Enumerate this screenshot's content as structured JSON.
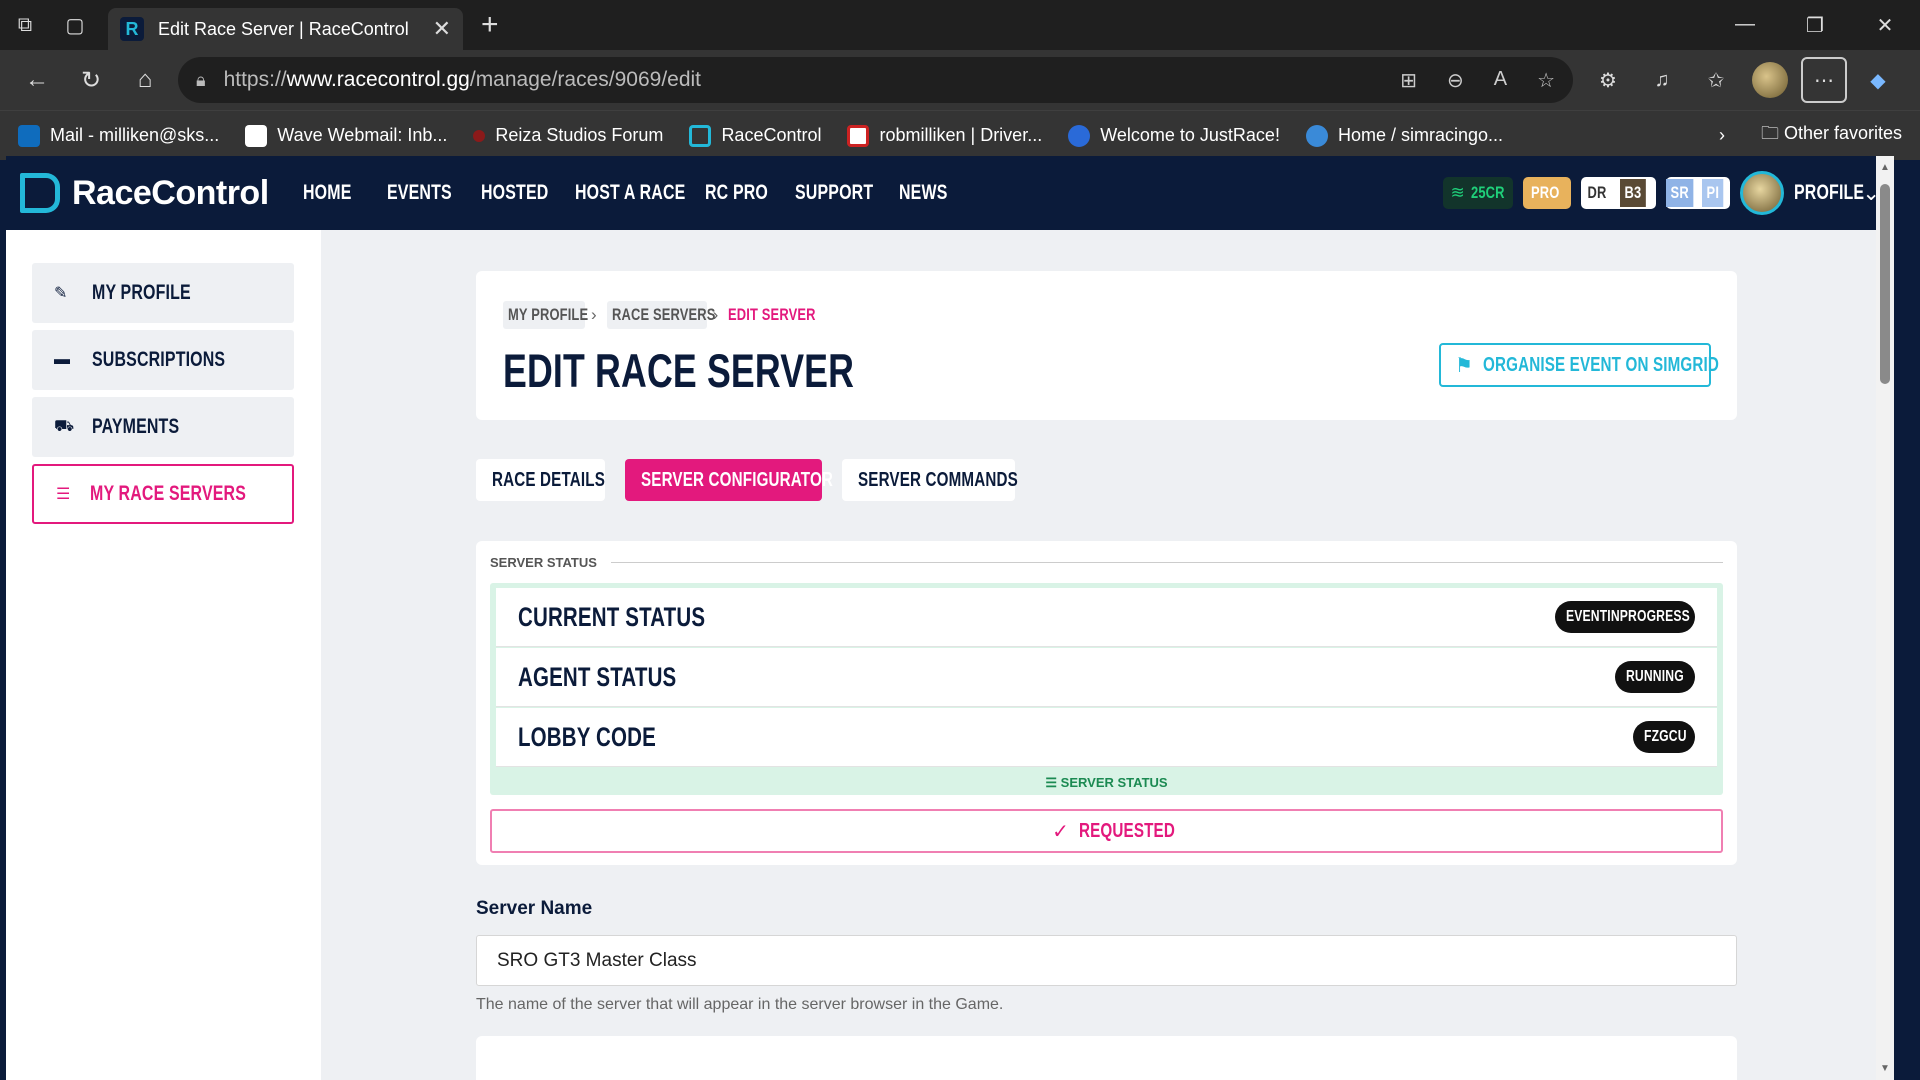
{
  "browser": {
    "tab_title": "Edit Race Server | RaceControl",
    "url_prefix": "https://",
    "url_domain": "www.racecontrol.gg",
    "url_path": "/manage/races/9069/edit",
    "bookmarks": [
      {
        "label": "Mail - milliken@sks...",
        "color": "#0f6cbd"
      },
      {
        "label": "Wave Webmail: Inb...",
        "color": "#ffffff"
      },
      {
        "label": "Reiza Studios Forum",
        "color": "#8b1a1a"
      },
      {
        "label": "RaceControl",
        "color": "#0b1b3a"
      },
      {
        "label": "robmilliken | Driver...",
        "color": "#cc2222"
      },
      {
        "label": "Welcome to JustRace!",
        "color": "#2a6ad8"
      },
      {
        "label": "Home / simracingo...",
        "color": "#3a8ad8"
      }
    ],
    "other_favorites": "Other favorites"
  },
  "site": {
    "logo": "RaceControl",
    "nav": [
      "HOME",
      "EVENTS",
      "HOSTED",
      "HOST A RACE",
      "RC PRO",
      "SUPPORT",
      "NEWS"
    ],
    "credits": "25CR",
    "pro": "PRO",
    "dr": "DR",
    "dr_level": "B3",
    "sr": "SR",
    "sr_level": "PI",
    "profile": "PROFILE",
    "accent": "#e3197d",
    "brand": "#23b8d8"
  },
  "sidebar": {
    "items": [
      {
        "label": "MY PROFILE",
        "icon": "pencil-icon"
      },
      {
        "label": "SUBSCRIPTIONS",
        "icon": "card-icon"
      },
      {
        "label": "PAYMENTS",
        "icon": "cart-icon"
      },
      {
        "label": "MY RACE SERVERS",
        "icon": "server-icon"
      }
    ]
  },
  "header": {
    "crumbs": [
      "MY PROFILE",
      "RACE SERVERS",
      "EDIT SERVER"
    ],
    "title": "EDIT RACE SERVER",
    "simgrid_button": "ORGANISE EVENT ON SIMGRID"
  },
  "tabs": [
    "RACE DETAILS",
    "SERVER CONFIGURATOR",
    "SERVER COMMANDS"
  ],
  "server_status": {
    "heading": "SERVER STATUS",
    "rows": [
      {
        "label": "CURRENT STATUS",
        "value": "EVENTINPROGRESS"
      },
      {
        "label": "AGENT STATUS",
        "value": "RUNNING"
      },
      {
        "label": "LOBBY CODE",
        "value": "FZGCU"
      }
    ],
    "footer": "SERVER STATUS",
    "requested": "REQUESTED"
  },
  "form": {
    "server_name_label": "Server Name",
    "server_name_value": "SRO GT3 Master Class",
    "server_name_help": "The name of the server that will appear in the server browser in the Game."
  }
}
